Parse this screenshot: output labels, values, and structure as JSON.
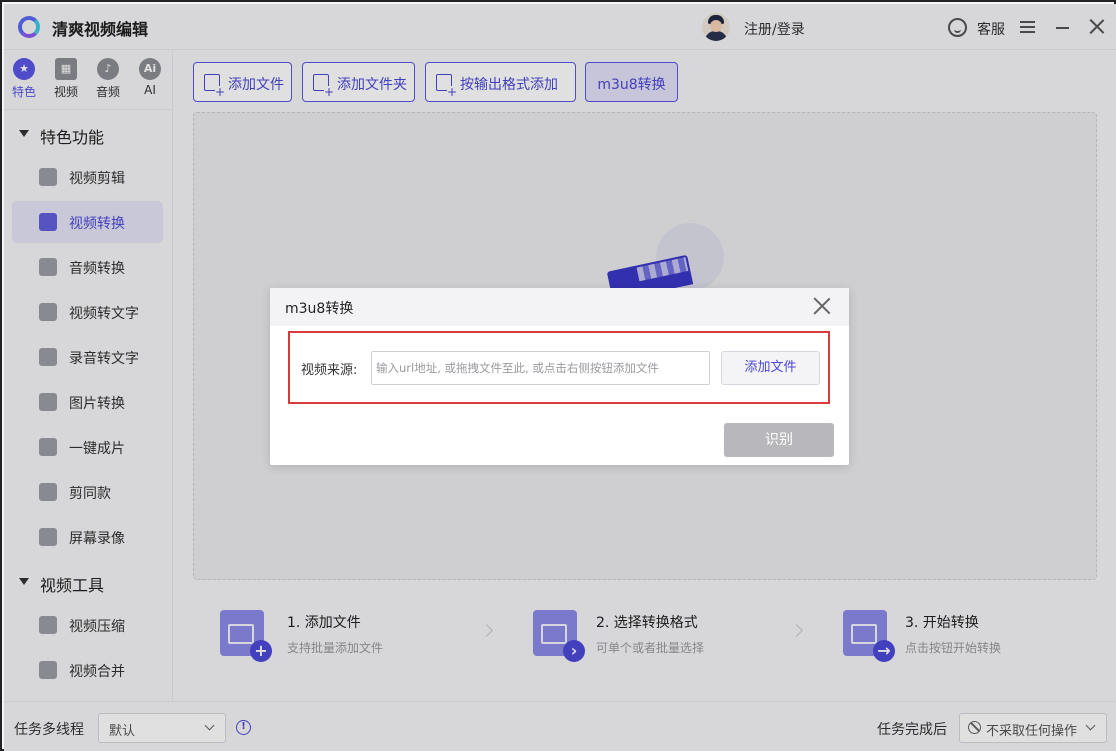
{
  "app": {
    "title": "清爽视频编辑"
  },
  "header": {
    "login": "注册/登录",
    "service": "客服"
  },
  "categories": [
    {
      "label": "特色",
      "icon": "star-icon",
      "glyph": "★"
    },
    {
      "label": "视频",
      "icon": "film-icon",
      "glyph": "▦"
    },
    {
      "label": "音频",
      "icon": "music-icon",
      "glyph": "♪"
    },
    {
      "label": "AI",
      "icon": "ai-icon",
      "glyph": "Ai"
    }
  ],
  "sidebar": {
    "groups": [
      {
        "title": "特色功能",
        "items": [
          {
            "label": "视频剪辑",
            "icon": "film-reel-icon"
          },
          {
            "label": "视频转换",
            "icon": "video-convert-icon"
          },
          {
            "label": "音频转换",
            "icon": "microphone-icon"
          },
          {
            "label": "视频转文字",
            "icon": "video-to-text-icon"
          },
          {
            "label": "录音转文字",
            "icon": "audio-to-text-icon"
          },
          {
            "label": "图片转换",
            "icon": "image-icon"
          },
          {
            "label": "一键成片",
            "icon": "play-icon"
          },
          {
            "label": "剪同款",
            "icon": "template-icon"
          },
          {
            "label": "屏幕录像",
            "icon": "screen-record-icon"
          }
        ]
      },
      {
        "title": "视频工具",
        "items": [
          {
            "label": "视频压缩",
            "icon": "compress-icon"
          },
          {
            "label": "视频合并",
            "icon": "merge-icon"
          }
        ]
      }
    ]
  },
  "toolbar": {
    "add_file": "添加文件",
    "add_folder": "添加文件夹",
    "add_by_format": "按输出格式添加",
    "m3u8": "m3u8转换"
  },
  "steps": [
    {
      "title": "1. 添加文件",
      "desc": "支持批量添加文件",
      "icon": "add-file-step-icon"
    },
    {
      "title": "2. 选择转换格式",
      "desc": "可单个或者批量选择",
      "icon": "select-format-step-icon"
    },
    {
      "title": "3. 开始转换",
      "desc": "点击按钮开始转换",
      "icon": "start-convert-step-icon"
    }
  ],
  "footer": {
    "threads_label": "任务多线程",
    "threads_value": "默认",
    "after_label": "任务完成后",
    "after_value": "不采取任何操作"
  },
  "modal": {
    "title": "m3u8转换",
    "source_label": "视频来源:",
    "source_placeholder": "输入url地址, 或拖拽文件至此, 或点击右侧按钮添加文件",
    "source_value": "",
    "add_file": "添加文件",
    "recognize": "识别"
  },
  "colors": {
    "accent": "#5a56e8",
    "highlight_box": "#d93a3a",
    "disabled": "#b8b8bc"
  }
}
